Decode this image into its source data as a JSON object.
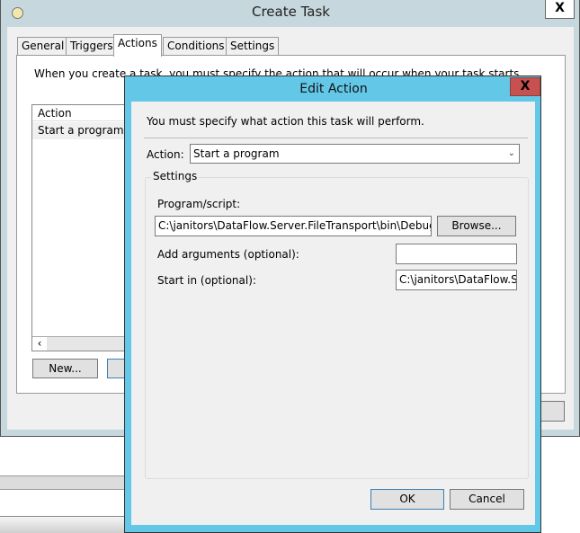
{
  "create_task": {
    "title": "Create Task",
    "close": "X",
    "tabs": [
      {
        "label": "General"
      },
      {
        "label": "Triggers"
      },
      {
        "label": "Actions"
      },
      {
        "label": "Conditions"
      },
      {
        "label": "Settings"
      }
    ],
    "description": "When you create a task, you must specify the action that will occur when your task starts.",
    "list_header": "Action",
    "rows": [
      {
        "action": "Start a program"
      }
    ],
    "scroll_left": "‹",
    "new_button": "New..."
  },
  "edit_action": {
    "title": "Edit Action",
    "close": "X",
    "instruction": "You must specify what action this task will perform.",
    "action_label": "Action:",
    "action_value": "Start a program",
    "settings_label": "Settings",
    "program_label": "Program/script:",
    "program_value": "C:\\janitors\\DataFlow.Server.FileTransport\\bin\\Debug\\filet",
    "browse": "Browse...",
    "args_label": "Add arguments (optional):",
    "args_value": "",
    "startin_label": "Start in (optional):",
    "startin_value": "C:\\janitors\\DataFlow.Ser",
    "ok": "OK",
    "cancel": "Cancel"
  }
}
